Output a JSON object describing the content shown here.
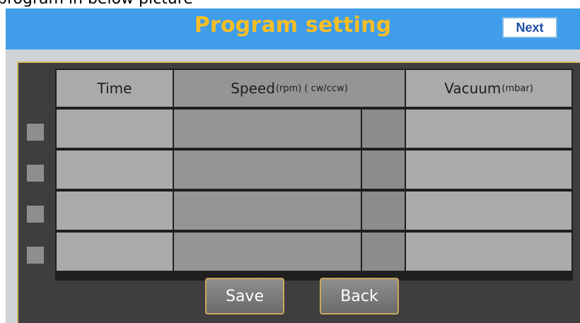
{
  "caption": "program in below picture",
  "header": {
    "title": "Program setting",
    "next_label": "Next"
  },
  "table": {
    "columns": {
      "time": "Time",
      "speed_main": "Speed",
      "speed_unit": "(rpm) ( cw/ccw)",
      "vacuum_main": "Vacuum",
      "vacuum_unit": "(mbar)"
    },
    "rows": [
      {
        "time": "",
        "speed": "",
        "direction": "",
        "vacuum": ""
      },
      {
        "time": "",
        "speed": "",
        "direction": "",
        "vacuum": ""
      },
      {
        "time": "",
        "speed": "",
        "direction": "",
        "vacuum": ""
      },
      {
        "time": "",
        "speed": "",
        "direction": "",
        "vacuum": ""
      }
    ]
  },
  "buttons": {
    "save_label": "Save",
    "back_label": "Back"
  },
  "colors": {
    "header_bg": "#3f9dea",
    "title": "#f7be26",
    "panel_bg": "#3e3e3e",
    "border_gold": "#d7b867"
  }
}
